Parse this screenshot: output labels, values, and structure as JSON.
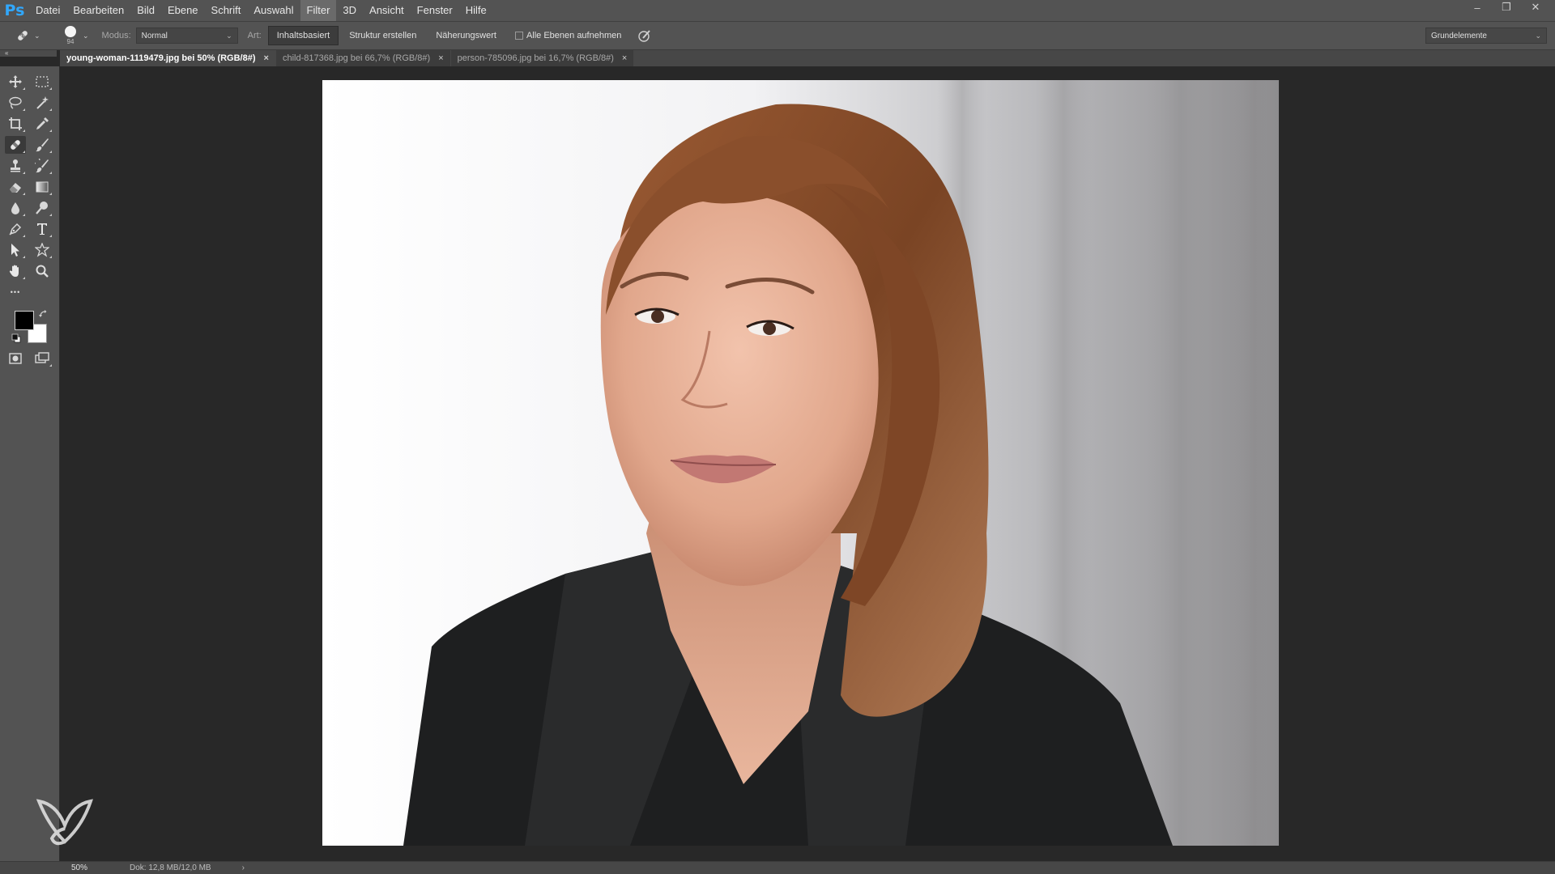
{
  "menubar": {
    "logo": "Ps",
    "items": [
      "Datei",
      "Bearbeiten",
      "Bild",
      "Ebene",
      "Schrift",
      "Auswahl",
      "Filter",
      "3D",
      "Ansicht",
      "Fenster",
      "Hilfe"
    ],
    "hovered_item": "Filter",
    "window_controls": {
      "minimize": "–",
      "restore": "❐",
      "close": "✕"
    }
  },
  "options": {
    "brush_size": "94",
    "mode_label": "Modus:",
    "mode_value": "Normal",
    "type_label": "Art:",
    "type_buttons": [
      "Inhaltsbasiert",
      "Struktur erstellen",
      "Näherungswert"
    ],
    "active_type": "Inhaltsbasiert",
    "sample_all_layers_label": "Alle Ebenen aufnehmen",
    "sample_all_layers_checked": false,
    "workspace_value": "Grundelemente"
  },
  "tabs": [
    {
      "label": "young-woman-1119479.jpg bei 50% (RGB/8#)",
      "active": true
    },
    {
      "label": "child-817368.jpg bei 66,7% (RGB/8#)",
      "active": false
    },
    {
      "label": "person-785096.jpg bei 16,7% (RGB/8#)",
      "active": false
    }
  ],
  "tab_close_glyph": "×",
  "collapse_glyph": "«",
  "toolbar": {
    "selected_tool": "spot-healing-brush-icon",
    "foreground_color": "#000000",
    "background_color": "#ffffff",
    "more_glyph": "•••"
  },
  "status": {
    "zoom": "50%",
    "doc_info": "Dok: 12,8 MB/12,0 MB",
    "arrow": "›"
  },
  "colors": {
    "accent": "#31a8ff",
    "ui_panel": "#535353",
    "workspace": "#282828"
  }
}
